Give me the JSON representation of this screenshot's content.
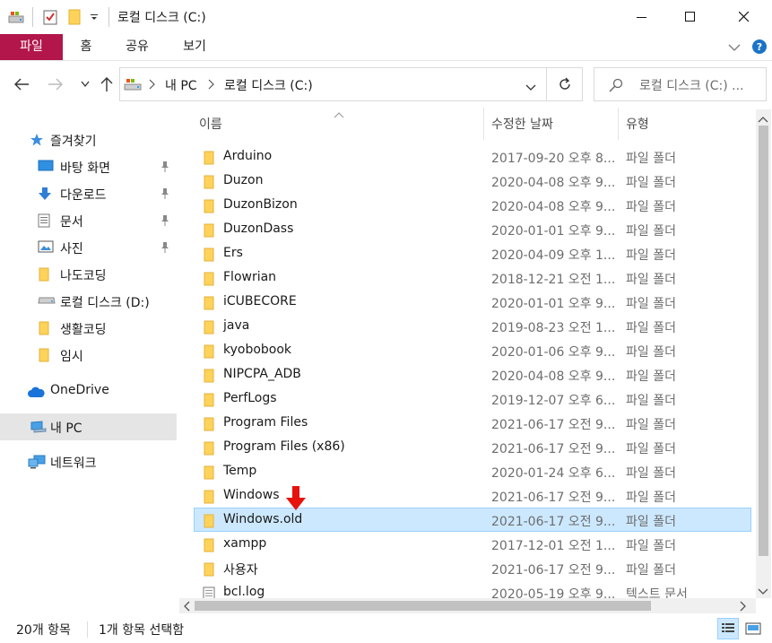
{
  "window": {
    "title": "로컬 디스크 (C:)"
  },
  "ribbon": {
    "tabs": [
      "파일",
      "홈",
      "공유",
      "보기"
    ]
  },
  "address": {
    "path": [
      "내 PC",
      "로컬 디스크 (C:)"
    ],
    "search_placeholder": "로컬 디스크 (C:) ..."
  },
  "nav": {
    "quick_access": "즐겨찾기",
    "items": [
      {
        "label": "바탕 화면",
        "icon": "desktop-icon",
        "pinned": true
      },
      {
        "label": "다운로드",
        "icon": "download-icon",
        "pinned": true
      },
      {
        "label": "문서",
        "icon": "document-icon",
        "pinned": true
      },
      {
        "label": "사진",
        "icon": "picture-icon",
        "pinned": true
      },
      {
        "label": "나도코딩",
        "icon": "folder-icon",
        "pinned": false
      },
      {
        "label": "로컬 디스크 (D:)",
        "icon": "drive-icon",
        "pinned": false
      },
      {
        "label": "생활코딩",
        "icon": "folder-icon",
        "pinned": false
      },
      {
        "label": "임시",
        "icon": "folder-icon",
        "pinned": false
      }
    ],
    "onedrive": "OneDrive",
    "thispc": "내 PC",
    "network": "네트워크"
  },
  "columns": {
    "name": "이름",
    "date": "수정한 날짜",
    "type": "유형"
  },
  "files": [
    {
      "name": "Arduino",
      "date": "2017-09-20 오후 8...",
      "type": "파일 폴더",
      "icon": "folder-icon"
    },
    {
      "name": "Duzon",
      "date": "2020-04-08 오후 9...",
      "type": "파일 폴더",
      "icon": "folder-icon"
    },
    {
      "name": "DuzonBizon",
      "date": "2020-04-08 오후 9...",
      "type": "파일 폴더",
      "icon": "folder-icon"
    },
    {
      "name": "DuzonDass",
      "date": "2020-01-01 오후 9...",
      "type": "파일 폴더",
      "icon": "folder-icon"
    },
    {
      "name": "Ers",
      "date": "2020-04-09 오후 1...",
      "type": "파일 폴더",
      "icon": "folder-icon"
    },
    {
      "name": "Flowrian",
      "date": "2018-12-21 오전 1...",
      "type": "파일 폴더",
      "icon": "folder-icon"
    },
    {
      "name": "iCUBECORE",
      "date": "2020-01-01 오후 9...",
      "type": "파일 폴더",
      "icon": "folder-icon"
    },
    {
      "name": "java",
      "date": "2019-08-23 오전 1...",
      "type": "파일 폴더",
      "icon": "folder-icon"
    },
    {
      "name": "kyobobook",
      "date": "2020-01-06 오후 9...",
      "type": "파일 폴더",
      "icon": "folder-icon"
    },
    {
      "name": "NIPCPA_ADB",
      "date": "2020-04-08 오후 9...",
      "type": "파일 폴더",
      "icon": "folder-icon"
    },
    {
      "name": "PerfLogs",
      "date": "2019-12-07 오후 6...",
      "type": "파일 폴더",
      "icon": "folder-icon"
    },
    {
      "name": "Program Files",
      "date": "2021-06-17 오전 9...",
      "type": "파일 폴더",
      "icon": "folder-icon"
    },
    {
      "name": "Program Files (x86)",
      "date": "2021-06-17 오전 9...",
      "type": "파일 폴더",
      "icon": "folder-icon"
    },
    {
      "name": "Temp",
      "date": "2020-01-24 오후 6...",
      "type": "파일 폴더",
      "icon": "folder-icon"
    },
    {
      "name": "Windows",
      "date": "2021-06-17 오전 9...",
      "type": "파일 폴더",
      "icon": "folder-icon"
    },
    {
      "name": "Windows.old",
      "date": "2021-06-17 오전 9...",
      "type": "파일 폴더",
      "icon": "folder-icon",
      "selected": true
    },
    {
      "name": "xampp",
      "date": "2017-12-01 오전 1...",
      "type": "파일 폴더",
      "icon": "folder-icon"
    },
    {
      "name": "사용자",
      "date": "2021-06-17 오전 9...",
      "type": "파일 폴더",
      "icon": "folder-icon"
    },
    {
      "name": "bcl.log",
      "date": "2020-05-19 오후 9...",
      "type": "텍스트 문서",
      "icon": "text-file-icon"
    }
  ],
  "status": {
    "item_count": "20개 항목",
    "selected_count": "1개 항목 선택함"
  },
  "colors": {
    "file_tab": "#b2164b",
    "selection": "#cce8ff",
    "folder": "#ffd35a",
    "annotation_arrow": "#e8120c"
  }
}
